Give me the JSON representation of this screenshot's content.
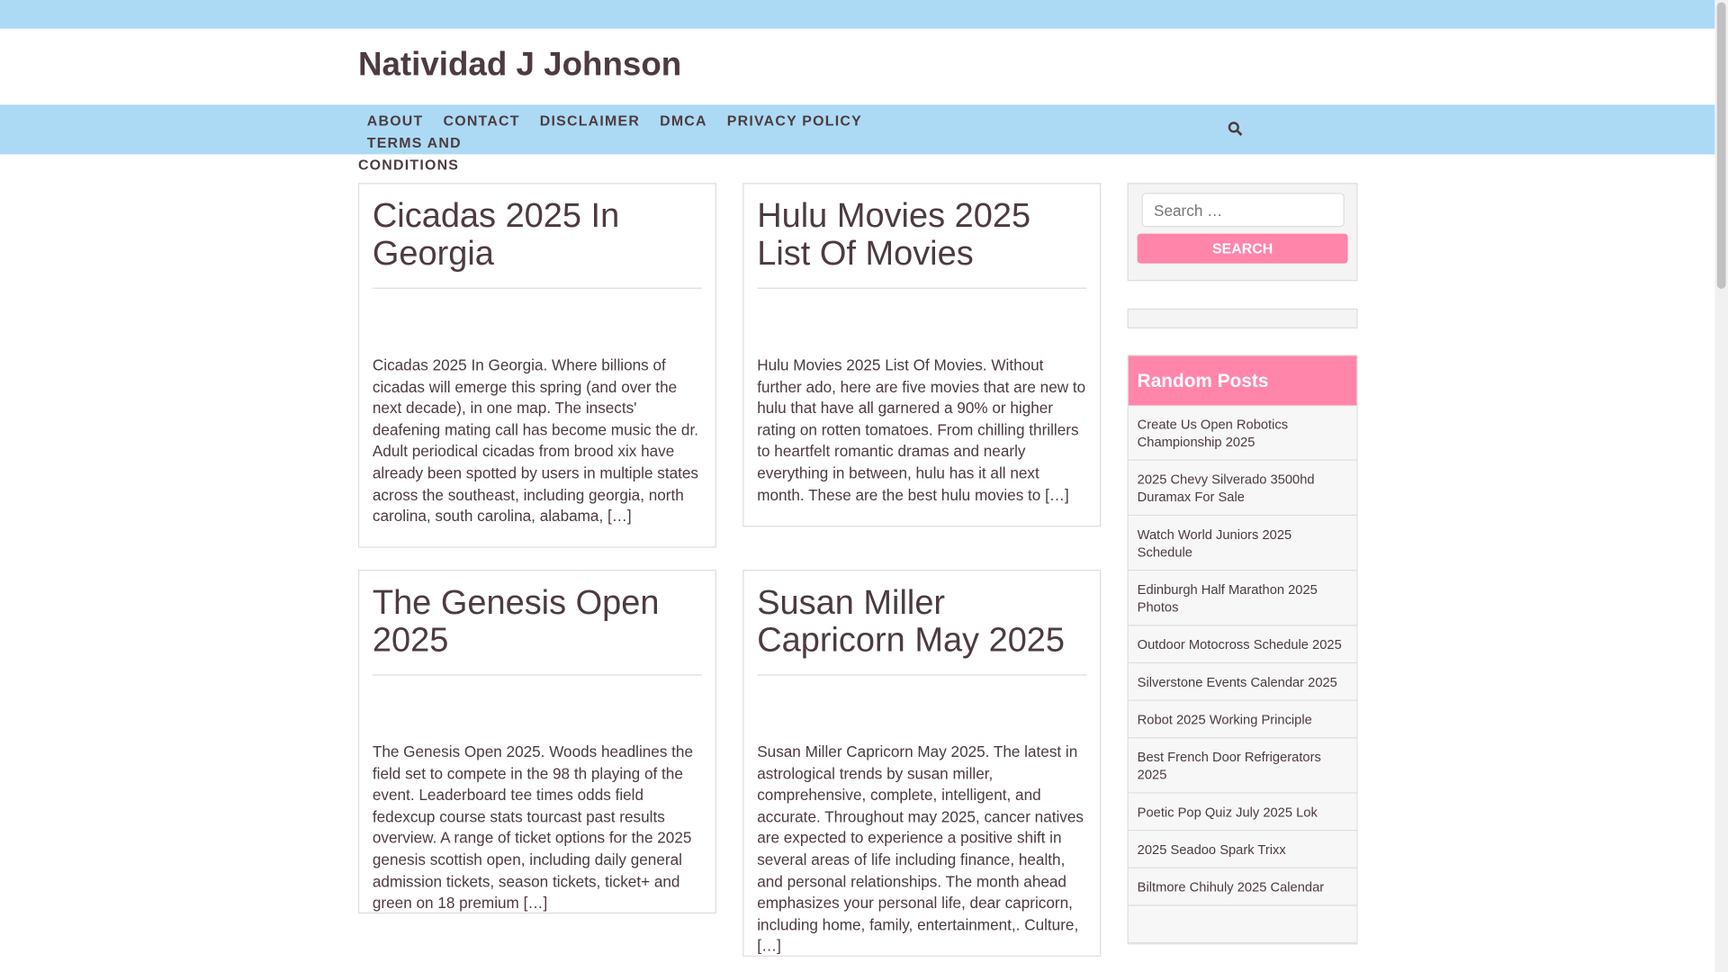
{
  "site_title": "Natividad J Johnson",
  "nav": [
    "ABOUT",
    "CONTACT",
    "DISCLAIMER",
    "DMCA",
    "PRIVACY POLICY",
    "TERMS AND",
    "CONDITIONS"
  ],
  "posts": [
    {
      "title": "Cicadas 2025 In Georgia",
      "excerpt": "Cicadas 2025 In Georgia. Where billions of cicadas will emerge this spring (and over the next decade), in one map. The insects' deafening mating call has become music the dr. Adult periodical cicadas from brood xix have already been spotted by users in multiple states across the southeast, including georgia, north carolina, south carolina, alabama, […]"
    },
    {
      "title": "Hulu Movies 2025 List Of Movies",
      "excerpt": "Hulu Movies 2025 List Of Movies. Without further ado, here are five movies that are new to hulu that have all garnered a 90% or higher rating on rotten tomatoes. From chilling thrillers to heartfelt romantic dramas and nearly everything in between, hulu has it all next month. These are the best hulu movies to […]"
    },
    {
      "title": "The Genesis Open 2025",
      "excerpt": "The Genesis Open 2025. Woods headlines the field set to compete in the 98 th playing of the event. Leaderboard tee times odds field fedexcup course stats tourcast past results overview. A range of ticket options for the 2025 genesis scottish open, including daily general admission tickets, season tickets, ticket+ and green on 18 premium […]"
    },
    {
      "title": "Susan Miller Capricorn May 2025",
      "excerpt": "Susan Miller Capricorn May 2025. The latest in astrological trends by susan miller, comprehensive, complete, intelligent, and accurate. Throughout may 2025, cancer natives are expected to experience a positive shift in several areas of life including finance, health, and personal relationships. The month ahead emphasizes your personal life, dear capricorn, including home, family, entertainment,. Culture, […]"
    }
  ],
  "search": {
    "placeholder": "Search …",
    "button": "SEARCH"
  },
  "random_posts": {
    "title": "Random Posts",
    "items": [
      "Create Us Open Robotics Championship 2025",
      "2025 Chevy Silverado 3500hd Duramax For Sale",
      "Watch World Juniors 2025 Schedule",
      "Edinburgh Half Marathon 2025 Photos",
      "Outdoor Motocross Schedule 2025",
      "Silverstone Events Calendar 2025",
      "Robot 2025 Working Principle",
      "Best French Door Refrigerators 2025",
      "Poetic Pop Quiz July 2025 Lok",
      "2025 Seadoo Spark Trixx",
      "Biltmore Chihuly 2025 Calendar",
      ""
    ]
  }
}
